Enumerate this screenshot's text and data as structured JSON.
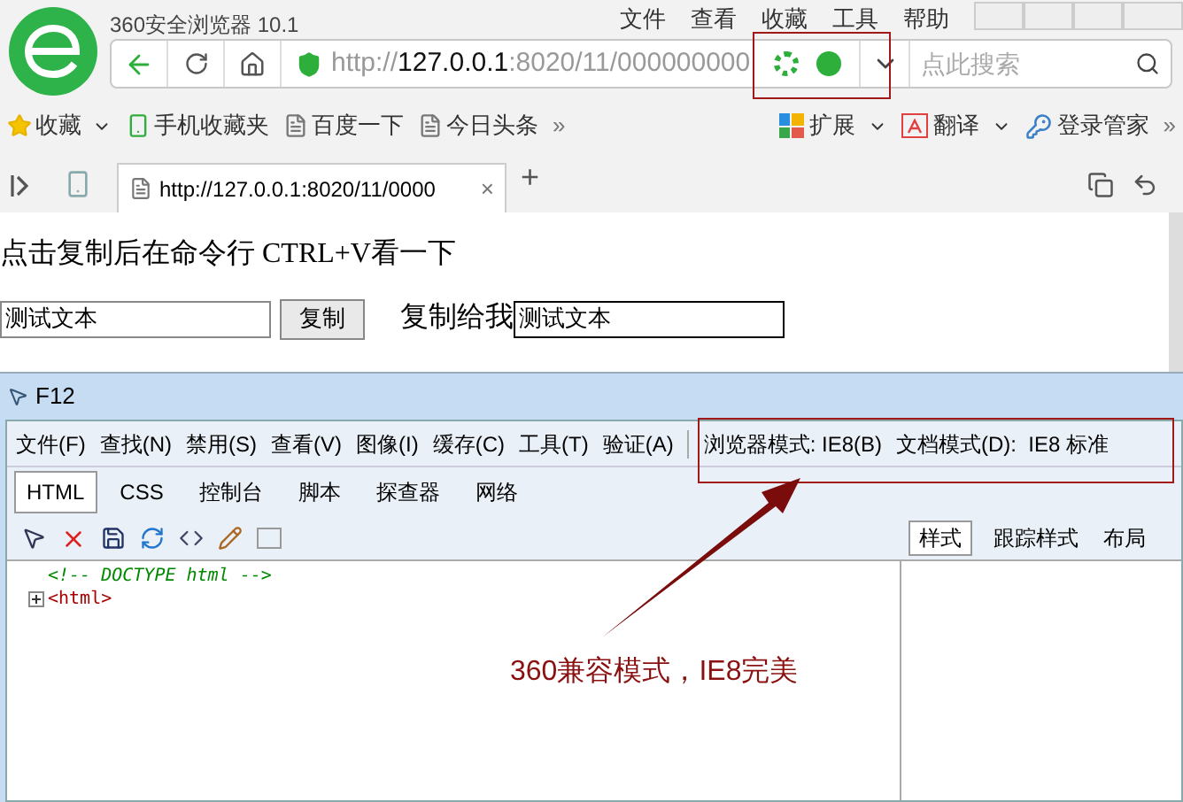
{
  "browser": {
    "title": "360安全浏览器 10.1",
    "menu": [
      "文件",
      "查看",
      "收藏",
      "工具",
      "帮助"
    ],
    "address": {
      "scheme": "http://",
      "host": "127.0.0.1",
      "rest": ":8020/11/000000000"
    },
    "search": {
      "placeholder": "点此搜索"
    },
    "bookmarks": [
      {
        "label": "收藏",
        "kind": "star"
      },
      {
        "label": "手机收藏夹",
        "kind": "phone"
      },
      {
        "label": "百度一下",
        "kind": "page"
      },
      {
        "label": "今日头条",
        "kind": "page"
      }
    ],
    "bookmarks_more": "»",
    "tools": [
      {
        "label": "扩展",
        "kind": "grid"
      },
      {
        "label": "翻译",
        "kind": "translate"
      },
      {
        "label": "登录管家",
        "kind": "key"
      }
    ],
    "tools_more": "»",
    "tab": {
      "title": "http://127.0.0.1:8020/11/0000",
      "close": "×",
      "new": "+"
    }
  },
  "page": {
    "instruction": "点击复制后在命令行 CTRL+V看一下",
    "source_value": "测试文本",
    "copy_button": "复制",
    "target_label": "复制给我",
    "target_value": "测试文本"
  },
  "devtools": {
    "title": "F12",
    "menu": [
      "文件(F)",
      "查找(N)",
      "禁用(S)",
      "查看(V)",
      "图像(I)",
      "缓存(C)",
      "工具(T)",
      "验证(A)"
    ],
    "modes": [
      "浏览器模式: IE8(B)",
      "文档模式(D):  IE8 标准"
    ],
    "tabs": [
      {
        "label": "HTML",
        "selected": true
      },
      {
        "label": "CSS",
        "selected": false
      },
      {
        "label": "控制台",
        "selected": false
      },
      {
        "label": "脚本",
        "selected": false
      },
      {
        "label": "探查器",
        "selected": false
      },
      {
        "label": "网络",
        "selected": false
      }
    ],
    "tree": [
      {
        "kind": "comment",
        "text": "<!-- DOCTYPE html -->"
      },
      {
        "kind": "element",
        "text": "<html>",
        "expanded": false
      }
    ],
    "side_tabs": [
      {
        "label": "样式",
        "selected": true
      },
      {
        "label": "跟踪样式",
        "selected": false
      },
      {
        "label": "布局",
        "selected": false
      }
    ]
  },
  "annotation": {
    "text": "360兼容模式，IE8完美"
  }
}
